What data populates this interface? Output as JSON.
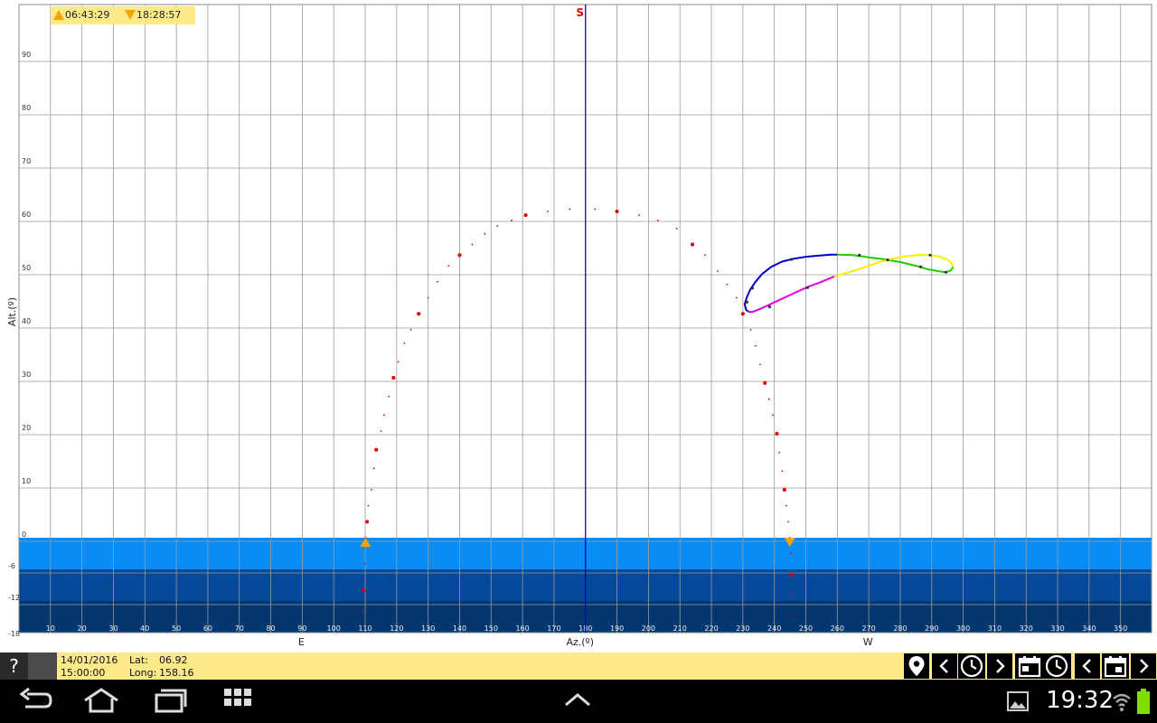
{
  "rise_set": {
    "rise": "06:43:29",
    "set": "18:28:57"
  },
  "chart_data": {
    "type": "scatter",
    "xlabel": "Az.(º)",
    "ylabel": "Alt.(º)",
    "xlim": [
      0,
      360
    ],
    "ylim": [
      -18,
      100
    ],
    "grid": true,
    "x_ticks": [
      10,
      20,
      30,
      40,
      50,
      60,
      70,
      80,
      90,
      100,
      110,
      120,
      130,
      140,
      150,
      160,
      170,
      180,
      190,
      200,
      210,
      220,
      230,
      240,
      250,
      260,
      270,
      280,
      290,
      300,
      310,
      320,
      330,
      340,
      350
    ],
    "y_ticks": [
      90,
      80,
      70,
      60,
      50,
      40,
      30,
      20,
      10,
      0,
      -6,
      -12,
      -18
    ],
    "cardinal_labels": [
      {
        "text": "E",
        "az": 90
      },
      {
        "text": "W",
        "az": 270
      }
    ],
    "south_label": "S",
    "south_az": 180,
    "bands": [
      {
        "from": 0,
        "to": -6,
        "color": "#0a8cf7"
      },
      {
        "from": -6,
        "to": -12,
        "color": "#04499a"
      },
      {
        "from": -12,
        "to": -18,
        "color": "#04376f"
      }
    ],
    "sun_path": {
      "color": "#e00000",
      "points": [
        [
          109.2,
          -14
        ],
        [
          109.5,
          -10
        ],
        [
          109.8,
          -5
        ],
        [
          110.1,
          0
        ],
        [
          110.6,
          3
        ],
        [
          111,
          6
        ],
        [
          112,
          9
        ],
        [
          112.8,
          13
        ],
        [
          113.5,
          16.5
        ],
        [
          115,
          20
        ],
        [
          116,
          23
        ],
        [
          117.5,
          26.5
        ],
        [
          119,
          30
        ],
        [
          120.5,
          33
        ],
        [
          122.5,
          36.5
        ],
        [
          124.5,
          39
        ],
        [
          127,
          42
        ],
        [
          130,
          45
        ],
        [
          133,
          48
        ],
        [
          136.5,
          51
        ],
        [
          140,
          53
        ],
        [
          144,
          55
        ],
        [
          148,
          57
        ],
        [
          152,
          58.5
        ],
        [
          156.5,
          59.5
        ],
        [
          161,
          60.5
        ],
        [
          168,
          61.2
        ],
        [
          175,
          61.6
        ],
        [
          183,
          61.6
        ],
        [
          190,
          61.2
        ],
        [
          197,
          60.5
        ],
        [
          203,
          59.5
        ],
        [
          209,
          58
        ],
        [
          214,
          55
        ],
        [
          218,
          53
        ],
        [
          222,
          50
        ],
        [
          225,
          47.5
        ],
        [
          228,
          45
        ],
        [
          230,
          42
        ],
        [
          232.5,
          39
        ],
        [
          234,
          36
        ],
        [
          235.5,
          32.5
        ],
        [
          237,
          29
        ],
        [
          238.3,
          26
        ],
        [
          239.5,
          23
        ],
        [
          240.8,
          19.5
        ],
        [
          241.6,
          16
        ],
        [
          242.5,
          12.5
        ],
        [
          243.2,
          9
        ],
        [
          243.8,
          6
        ],
        [
          244.4,
          3
        ],
        [
          244.9,
          0
        ],
        [
          245.3,
          -3
        ],
        [
          245.6,
          -7
        ],
        [
          245.9,
          -11
        ],
        [
          246.2,
          -15
        ]
      ],
      "big_dots": [
        [
          110.6,
          3
        ],
        [
          113.5,
          16.5
        ],
        [
          119,
          30
        ],
        [
          127,
          42
        ],
        [
          140,
          53
        ],
        [
          161,
          60.5
        ],
        [
          190,
          61.2
        ],
        [
          214,
          55
        ],
        [
          230,
          42
        ],
        [
          237,
          29
        ],
        [
          240.8,
          19.5
        ],
        [
          243.2,
          9
        ],
        [
          109.5,
          -10
        ],
        [
          245.6,
          -7
        ]
      ],
      "rise_marker": {
        "az": 110.1,
        "alt": 0
      },
      "set_marker": {
        "az": 244.9,
        "alt": 0
      }
    },
    "analemma": {
      "series": [
        {
          "color": "#0000c0",
          "points": [
            [
              231.7,
              42.4
            ],
            [
              231,
              42.8
            ],
            [
              230.6,
              43.8
            ],
            [
              231.2,
              45
            ],
            [
              232.3,
              46.5
            ],
            [
              234,
              48
            ],
            [
              236.2,
              49.5
            ],
            [
              239,
              50.8
            ],
            [
              242.5,
              51.8
            ],
            [
              246,
              52.3
            ],
            [
              250,
              52.7
            ],
            [
              254,
              52.9
            ],
            [
              258,
              53.1
            ],
            [
              260,
              53.1
            ]
          ]
        },
        {
          "color": "#22cc00",
          "points": [
            [
              260,
              53.1
            ],
            [
              265,
              53
            ],
            [
              270,
              52.6
            ],
            [
              275,
              52.2
            ],
            [
              280,
              51.7
            ],
            [
              285,
              51
            ],
            [
              289,
              50.3
            ],
            [
              292,
              50
            ],
            [
              294.5,
              49.8
            ],
            [
              296,
              50.1
            ],
            [
              296.9,
              50.8
            ]
          ]
        },
        {
          "color": "#f0f000",
          "points": [
            [
              296.9,
              50.8
            ],
            [
              296.2,
              51.6
            ],
            [
              294.5,
              52.3
            ],
            [
              292,
              52.8
            ],
            [
              289,
              53
            ],
            [
              285.5,
              53
            ],
            [
              282,
              52.8
            ],
            [
              278,
              52.4
            ],
            [
              274,
              51.8
            ],
            [
              270,
              51
            ],
            [
              266,
              50.2
            ],
            [
              262,
              49.5
            ],
            [
              259,
              49
            ]
          ]
        },
        {
          "color": "#e000e0",
          "points": [
            [
              259,
              49
            ],
            [
              255,
              48
            ],
            [
              250.5,
              47
            ],
            [
              246,
              45.8
            ],
            [
              242,
              44.7
            ],
            [
              238,
              43.6
            ],
            [
              235,
              42.8
            ],
            [
              232.8,
              42.3
            ],
            [
              231.7,
              42.4
            ]
          ]
        }
      ],
      "dots": [
        [
          231.3,
          44.2
        ],
        [
          233,
          46.8
        ],
        [
          245.5,
          52.2
        ],
        [
          267,
          53
        ],
        [
          276,
          52.1
        ],
        [
          286.5,
          50.8
        ],
        [
          294.5,
          49.8
        ],
        [
          289.5,
          53
        ],
        [
          250.5,
          46.9
        ],
        [
          238.5,
          43.3
        ]
      ]
    }
  },
  "status": {
    "help": "?",
    "date": "14/01/2016",
    "time": "15:00:00",
    "lat_label": "Lat:",
    "lat": "06.92",
    "long_label": "Long:",
    "long": "158.16"
  },
  "toolbar_icons": [
    "location-pin-icon",
    "chevron-left-icon",
    "clock-icon",
    "chevron-right-icon",
    "calendar-clock-icon",
    "clock-icon",
    "chevron-left-icon",
    "calendar-icon",
    "chevron-right-icon"
  ],
  "system": {
    "clock": "19:32",
    "battery_color": "#7fe000"
  }
}
